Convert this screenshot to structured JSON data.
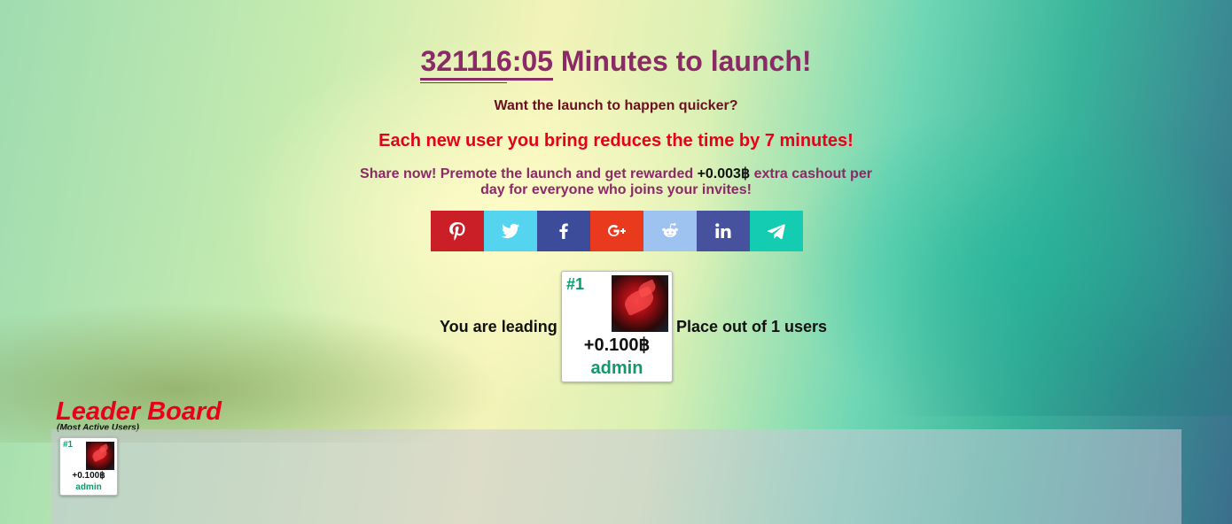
{
  "countdown": {
    "timer": "321116:05",
    "suffix": " Minutes to launch!"
  },
  "prompt": "Want the launch to happen quicker?",
  "reduce_text": "Each new user you bring reduces the time by 7 minutes!",
  "share": {
    "before": "Share now! Premote the launch and get rewarded ",
    "amount": "+0.003฿",
    "after": " extra cashout per day for everyone who joins your invites!"
  },
  "social": [
    {
      "name": "pinterest",
      "color": "#cb1f27"
    },
    {
      "name": "twitter",
      "color": "#55d4f0"
    },
    {
      "name": "facebook",
      "color": "#3c4b9a"
    },
    {
      "name": "google-plus",
      "color": "#e93a1e"
    },
    {
      "name": "reddit",
      "color": "#9fc3f0"
    },
    {
      "name": "linkedin",
      "color": "#46529e"
    },
    {
      "name": "telegram",
      "color": "#14ccb2"
    }
  ],
  "leading": {
    "prefix": "You are leading",
    "suffix": "Place out of 1 users",
    "card": {
      "rank": "#1",
      "amount": "+0.100฿",
      "username": "admin"
    }
  },
  "leaderboard": {
    "title": "Leader Board",
    "subtitle": "(Most Active Users)",
    "entries": [
      {
        "rank": "#1",
        "amount": "+0.100฿",
        "username": "admin"
      }
    ]
  },
  "colors": {
    "accent": "#8a2a66",
    "alert": "#e8001a",
    "username": "#0e9a6b"
  }
}
